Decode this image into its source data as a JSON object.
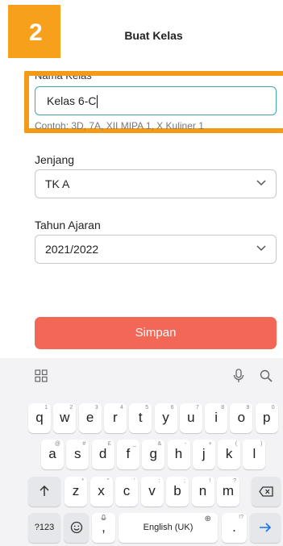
{
  "step_number": "2",
  "header": {
    "title": "Buat Kelas"
  },
  "form": {
    "class_name": {
      "label": "Nama Kelas",
      "value": "Kelas 6-C",
      "hint": "Contoh: 3D, 7A, XII MIPA 1, X Kuliner 1"
    },
    "level": {
      "label": "Jenjang",
      "value": "TK A"
    },
    "year": {
      "label": "Tahun Ajaran",
      "value": "2021/2022"
    }
  },
  "actions": {
    "save_label": "Simpan"
  },
  "keyboard": {
    "row1": [
      {
        "key": "q",
        "hint": "1"
      },
      {
        "key": "w",
        "hint": "2"
      },
      {
        "key": "e",
        "hint": "3"
      },
      {
        "key": "r",
        "hint": "4"
      },
      {
        "key": "t",
        "hint": "5"
      },
      {
        "key": "y",
        "hint": "6"
      },
      {
        "key": "u",
        "hint": "7"
      },
      {
        "key": "i",
        "hint": "8"
      },
      {
        "key": "o",
        "hint": "9"
      },
      {
        "key": "p",
        "hint": "0"
      }
    ],
    "row2": [
      {
        "key": "a",
        "hint": "@"
      },
      {
        "key": "s",
        "hint": "#"
      },
      {
        "key": "d",
        "hint": "£"
      },
      {
        "key": "f",
        "hint": "_"
      },
      {
        "key": "g",
        "hint": "&"
      },
      {
        "key": "h",
        "hint": "-"
      },
      {
        "key": "j",
        "hint": "+"
      },
      {
        "key": "k",
        "hint": "("
      },
      {
        "key": "l",
        "hint": ")"
      }
    ],
    "row3": [
      {
        "key": "z",
        "hint": "*"
      },
      {
        "key": "x",
        "hint": "\""
      },
      {
        "key": "c",
        "hint": "'"
      },
      {
        "key": "v",
        "hint": ":"
      },
      {
        "key": "b",
        "hint": ";"
      },
      {
        "key": "n",
        "hint": "!"
      },
      {
        "key": "m",
        "hint": "?"
      }
    ],
    "symbols_label": "?123",
    "comma_label": ",",
    "space_label": "English (UK)",
    "period_label": ".",
    "period_hint": "!?"
  }
}
